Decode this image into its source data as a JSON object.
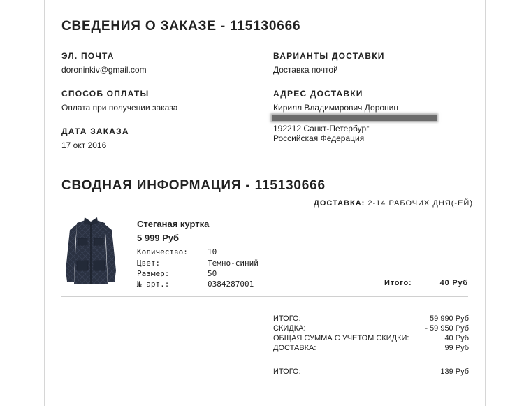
{
  "order": {
    "title": "СВЕДЕНИЯ О ЗАКАЗЕ - 115130666",
    "email_label": "ЭЛ. ПОЧТА",
    "email_value": "doroninkiv@gmail.com",
    "payment_label": "СПОСОБ ОПЛАТЫ",
    "payment_value": "Оплата при получении заказа",
    "date_label": "ДАТА ЗАКАЗА",
    "date_value": "17 окт 2016",
    "delivery_options_label": "ВАРИАНТЫ ДОСТАВКИ",
    "delivery_options_value": "Доставка почтой",
    "address_label": "АДРЕС ДОСТАВКИ",
    "address_name": "Кирилл Владимирович Доронин",
    "address_city": "192212 Санкт-Петербург",
    "address_country": "Российская Федерация"
  },
  "summary": {
    "title": "СВОДНАЯ ИНФОРМАЦИЯ - 115130666",
    "delivery_label": "ДОСТАВКА:",
    "delivery_value": "2-14 РАБОЧИХ ДНЯ(-ЕЙ)"
  },
  "item": {
    "name": "Стеганая куртка",
    "price": "5 999 Руб",
    "qty_label": "Количество:",
    "qty_value": "10",
    "color_label": "Цвет:",
    "color_value": "Темно-синий",
    "size_label": "Размер:",
    "size_value": "50",
    "art_label": "№ арт.:",
    "art_value": "0384287001",
    "total_label": "Итого:",
    "total_value": "40 Руб",
    "image_icon": "quilted-jacket-image",
    "jacket_color": "#2b3242"
  },
  "totals": {
    "rows": [
      {
        "label": "ИТОГО:",
        "value": "59 990 Руб"
      },
      {
        "label": "СКИДКА:",
        "value": "- 59 950 Руб"
      },
      {
        "label": "ОБЩАЯ СУММА С УЧЕТОМ СКИДКИ:",
        "value": "40 Руб"
      },
      {
        "label": "ДОСТАВКА:",
        "value": "99 Руб"
      }
    ],
    "grand_label": "ИТОГО:",
    "grand_value": "139 Руб"
  }
}
